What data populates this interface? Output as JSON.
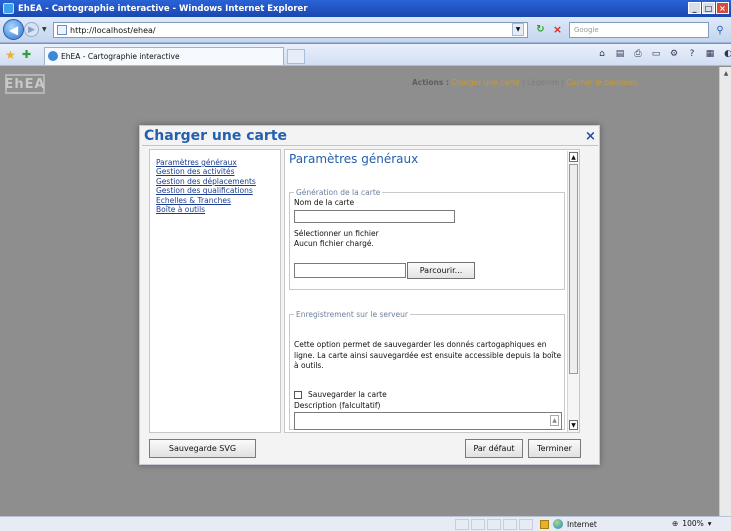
{
  "window": {
    "title": "EhEA - Cartographie interactive - Windows Internet Explorer",
    "address": "http://localhost/ehea/",
    "search_placeholder": "Google",
    "tab_title": "EhEA - Cartographie interactive"
  },
  "page": {
    "logo": "EhEA",
    "actions": {
      "label": "Actions :",
      "load_link": "Charger une carte",
      "separator": "|",
      "legend": "Légende",
      "hide_banner": "Cacher le bandeau"
    }
  },
  "dialog": {
    "title": "Charger une carte",
    "close": "×",
    "nav_links": [
      "Paramètres généraux",
      "Gestion des activités",
      "Gestion des déplacements",
      "Gestion des qualifications",
      "Echelles & Tranches",
      "Boîte à outils"
    ],
    "content": {
      "title": "Paramètres généraux",
      "generation": {
        "legend": "Génération de la carte",
        "map_name_label": "Nom de la carte",
        "map_name_value": "",
        "select_file_label": "Sélectionner un fichier",
        "no_file_label": "Aucun fichier chargé.",
        "file_value": "",
        "browse_button": "Parcourir..."
      },
      "server": {
        "legend": "Enregistrement sur le serveur",
        "description": "Cette option permet de sauvegarder les donnés cartogaphiques en ligne. La carte ainsi sauvegardée est ensuite accessible depuis la boîte à outils.",
        "save_checkbox_label": "Sauvegarder la carte",
        "save_checked": false,
        "description_label": "Description (falcultatif)",
        "description_value": ""
      }
    },
    "buttons": {
      "svg": "Sauvegarde SVG",
      "default": "Par défaut",
      "finish": "Terminer"
    }
  },
  "statusbar": {
    "zone": "Internet",
    "zoom": "100%"
  }
}
